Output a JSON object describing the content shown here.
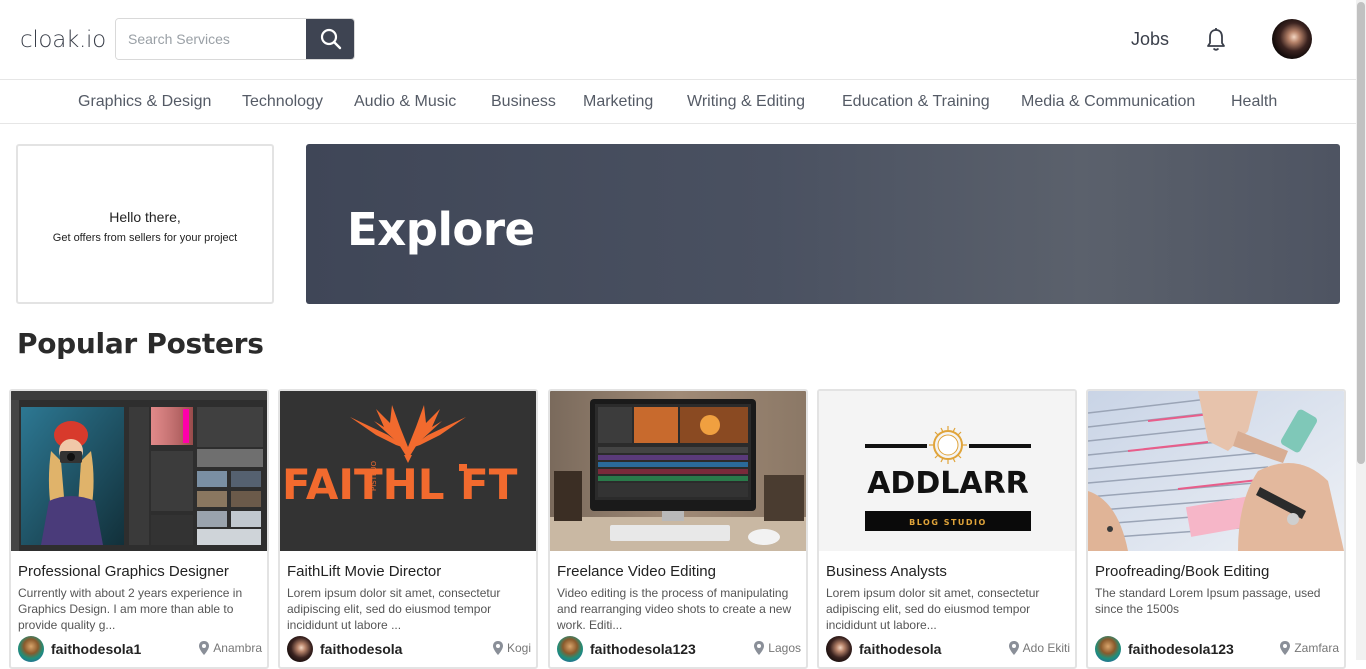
{
  "header": {
    "logo": "cloak.io",
    "search_placeholder": "Search Services",
    "jobs_label": "Jobs"
  },
  "categories": [
    "Graphics & Design",
    "Technology",
    "Audio & Music",
    "Business",
    "Marketing",
    "Writing & Editing",
    "Education & Training",
    "Media & Communication",
    "Health"
  ],
  "hello": {
    "greeting": "Hello there,",
    "subtitle": "Get offers from sellers for your project"
  },
  "banner": {
    "title": "Explore"
  },
  "popular": {
    "title": "Popular Posters",
    "cards": [
      {
        "title": "Professional Graphics Designer",
        "desc": "Currently with about 2 years experience in Graphics Design. I am more than able to provide quality g...",
        "user": "faithodesola1",
        "location": "Anambra"
      },
      {
        "title": "FaithLift Movie Director",
        "desc": "Lorem ipsum dolor sit amet, consectetur adipiscing elit, sed do eiusmod tempor incididunt ut labore ...",
        "user": "faithodesola",
        "location": "Kogi",
        "brand_text": "FAITHL",
        "brand_text2": "FT",
        "brand_vertical": "PISTEUO"
      },
      {
        "title": "Freelance Video Editing",
        "desc": "Video editing is the process of manipulating and rearranging video shots to create a new work. Editi...",
        "user": "faithodesola123",
        "location": "Lagos"
      },
      {
        "title": "Business Analysts",
        "desc": "Lorem ipsum dolor sit amet, consectetur adipiscing elit, sed do eiusmod tempor incididunt ut labore...",
        "user": "faithodesola",
        "location": "Ado Ekiti",
        "brand_text": "ADDLARR",
        "brand_sub": "BLOG STUDIO"
      },
      {
        "title": "Proofreading/Book Editing",
        "desc": "The standard Lorem Ipsum passage, used since the 1500s",
        "user": "faithodesola123",
        "location": "Zamfara"
      }
    ]
  },
  "icons": {
    "search": "search-icon",
    "bell": "bell-icon",
    "pin": "location-pin-icon"
  },
  "colors": {
    "primary_dark": "#3e4452",
    "banner": "#4a5161",
    "faithlift_orange": "#f26a2e"
  }
}
